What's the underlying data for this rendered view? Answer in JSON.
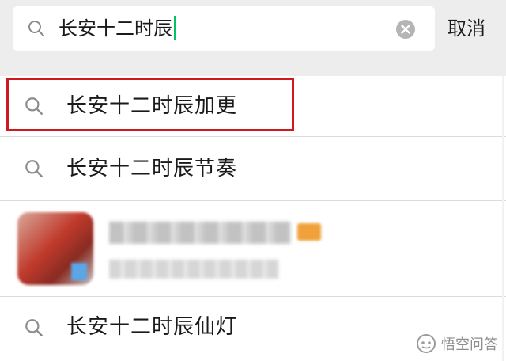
{
  "search": {
    "query": "长安十二时辰",
    "cancel_label": "取消",
    "icon": "search-icon",
    "clear_icon": "clear-icon"
  },
  "suggestions": [
    {
      "text": "长安十二时辰加更",
      "highlighted": true
    },
    {
      "text": "长安十二时辰节奏"
    },
    {
      "text": "长安十二时辰仙灯"
    }
  ],
  "colors": {
    "highlight_border": "#d0191f",
    "caret": "#07c160",
    "background": "#ededed"
  },
  "watermark": {
    "text": "悟空问答",
    "icon": "wukong-logo-icon"
  }
}
